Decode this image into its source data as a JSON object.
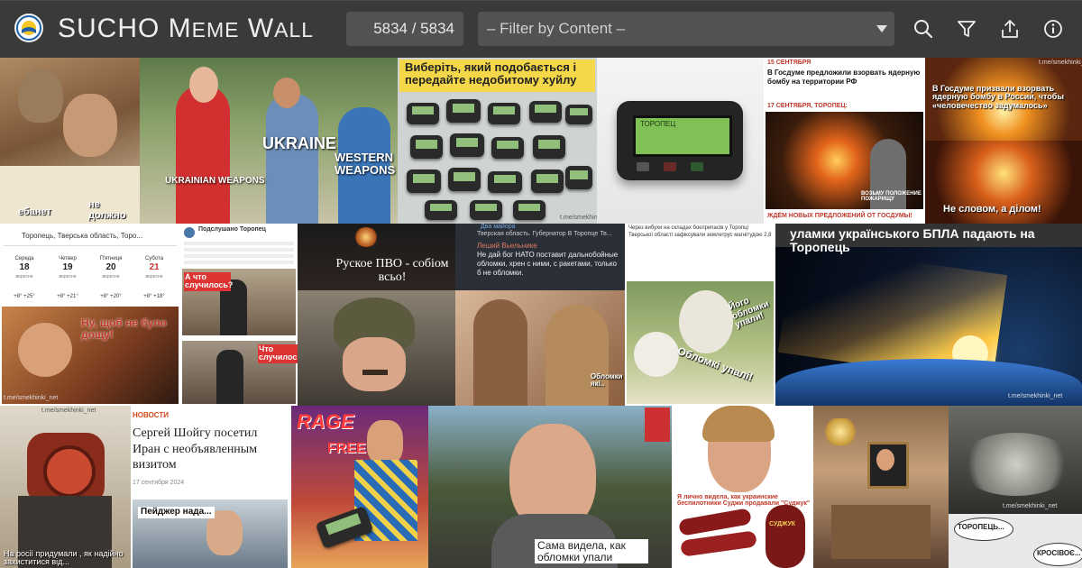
{
  "header": {
    "title_part1": "SUCHO M",
    "title_part2": "EME",
    "title_part3": " W",
    "title_part4": "ALL",
    "counter": "5834 / 5834",
    "filter_placeholder": "– Filter by Content –",
    "icons": [
      "search-icon",
      "filter-icon",
      "share-icon",
      "info-icon"
    ]
  },
  "colors": {
    "header_bg": "#3a3a3a",
    "field_bg": "#525252",
    "text": "#eeeeee"
  },
  "memes": {
    "m1": {
      "a": "ебанет",
      "b": "не должно"
    },
    "m2": {
      "a": "UKRAINE",
      "b": "WESTERN WEAPONS",
      "c": "UKRAINIAN WEAPONS"
    },
    "m3": {
      "a": "Виберіть, який подобається і передайте недобитому хуйлу"
    },
    "m4": {
      "a": "ТОРОПЕЦ"
    },
    "m5": {
      "date1": "15 СЕНТЯБРЯ",
      "head1": "В Госдуме предложили взорвать ядерную бомбу на территории РФ",
      "date2": "17 СЕНТЯБРЯ, ТОРОПЕЦ:",
      "cap": "ВОЗЬМУ ПОЛОЖЕНИЕ ПОЖАРИЩУ",
      "foot": "ЖДЁМ НОВЫХ ПРЕДЛОЖЕНИЙ ОТ ГОСДУМЫ!"
    },
    "m6": {
      "a": "В Госдуме призвали взорвать ядерную бомбу в России, чтобы «человечество задумалось»",
      "b": "Не словом, а ділом!"
    },
    "m7": {
      "search": "Торопець, Тверська область, Торо...",
      "days": [
        "Середа",
        "Четвер",
        "П'ятниця",
        "Субота"
      ],
      "dates": [
        "18",
        "19",
        "20",
        "21"
      ],
      "month": "вересня",
      "temps": [
        "+8° +25°",
        "+8° +21°",
        "+8° +20°",
        "+8° +18°"
      ],
      "cap": "Ну, щоб не було дощу!"
    },
    "m8": {
      "name": "Подслушано Торопец",
      "a": "А что случилось?",
      "b": "Что случилось?"
    },
    "m9": {
      "a": "Руское ПВО - собіом всьо!"
    },
    "m10": {
      "chan": "Два майора",
      "sub": "Тверская область. Губернатор В Торопце Тв...",
      "who": "Леший Вьельнике",
      "msg": "Не дай бог НАТО поставит дальнобойные обломки, хрен с ними, с ракетами, только б не обломки."
    },
    "m11": {
      "a": "Облом­ки які.."
    },
    "m12": {
      "text": "Через вибухи на складах боєприпасів у Торопці Тверської області зафіксували землетрус магнітудою 2,8",
      "a": "Його обломки упали!",
      "b": "Обломкі упалі!"
    },
    "m13": {
      "a": "уламки українського БПЛА падають на Торопець"
    },
    "m14": {
      "a": "На росії придумали , як надійно захиститися від..."
    },
    "m15": {
      "section": "НОВОСТИ",
      "head": "Сергей Шойгу посетил Иран с необъявленным визитом",
      "date": "17 сентября 2024",
      "cap": "Пейджер нада..."
    },
    "m16": {
      "a": "RAGE",
      "b": "FREE!"
    },
    "m17": {
      "a": "Сама видела, как обломки упали"
    },
    "m18": {
      "a": "Я лично видела, как украинские беспилотники Суджи продавали \"Суджук\"",
      "brand": "СУДЖУК"
    },
    "m20": {
      "a": "ТОРОПЕЦЬ...",
      "b": "КРОСІВОЄ..."
    },
    "watermark": "t.me/smekhinki_net"
  }
}
